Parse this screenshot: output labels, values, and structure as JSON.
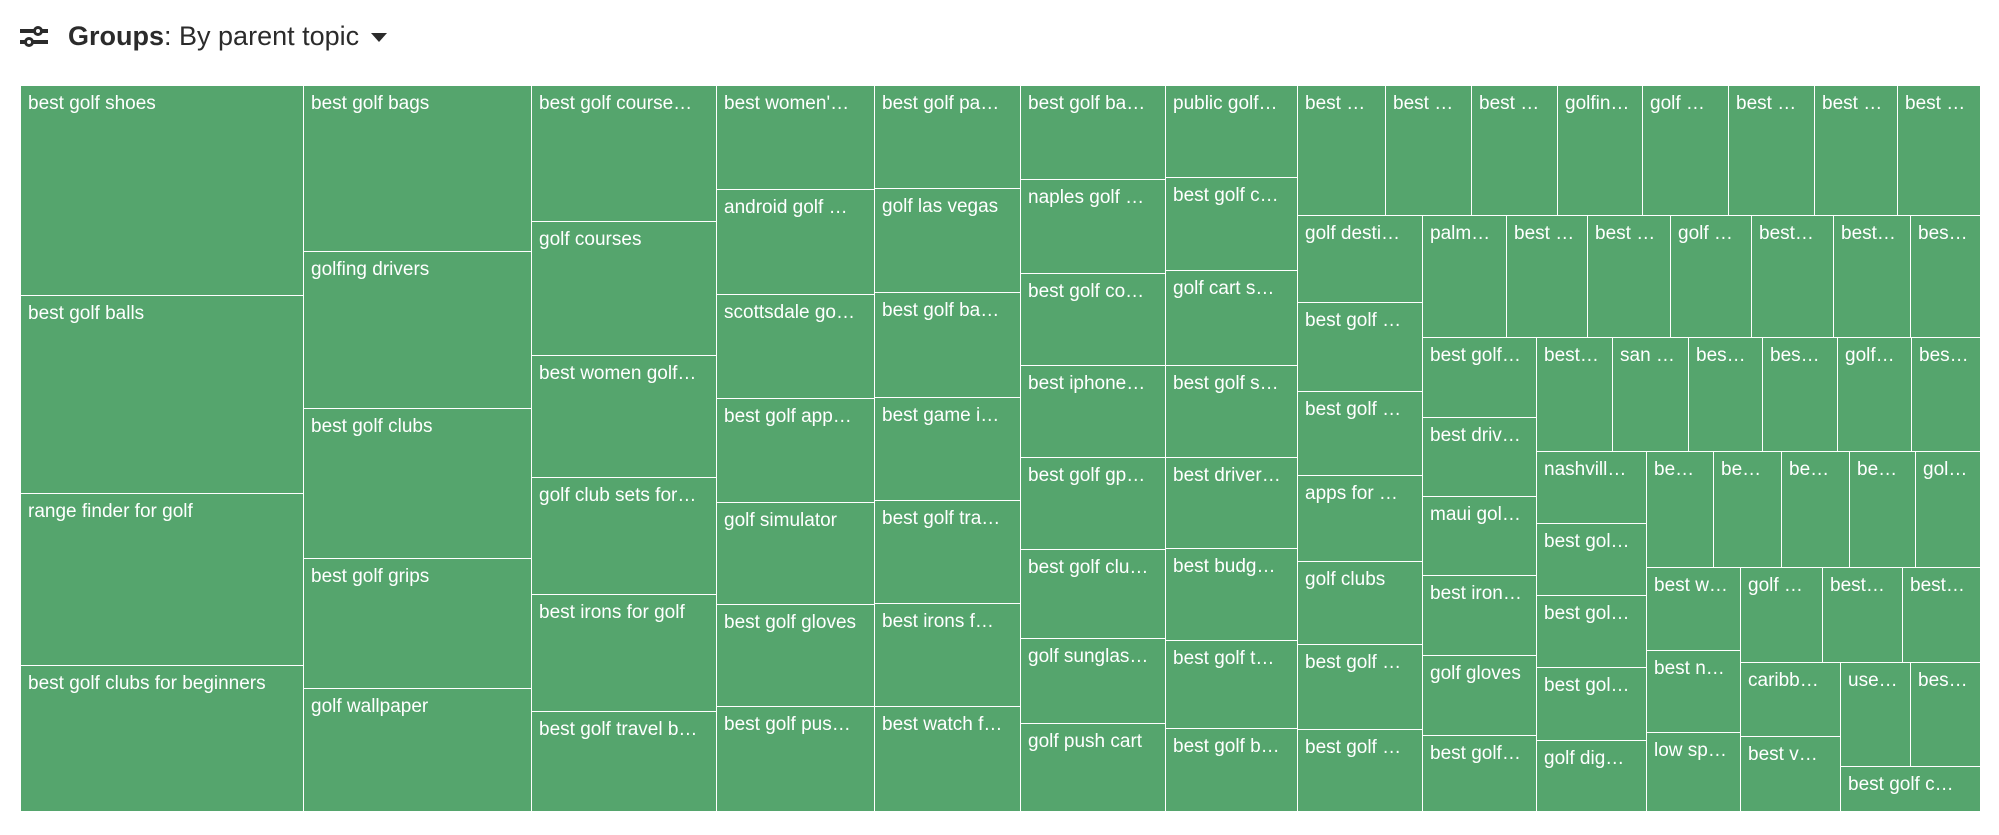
{
  "header": {
    "icon": "sliders-icon",
    "groups_label": "Groups",
    "groups_value": "By parent topic",
    "dropdown_icon": "caret-down-icon"
  },
  "colors": {
    "cell_fill": "#55a56d",
    "cell_border": "#ffffff",
    "label": "#ffffff",
    "header_text": "#2b2b2b"
  },
  "chart_data": {
    "type": "treemap",
    "title": "Groups: By parent topic",
    "cells": [
      "best golf shoes",
      "best golf balls",
      "range finder for golf",
      "best golf clubs for beginners",
      "best golf bags",
      "golfing drivers",
      "best golf clubs",
      "best golf grips",
      "golf wallpaper",
      "best golf course…",
      "golf courses",
      "best women golf…",
      "golf club sets for…",
      "best irons for golf",
      "best golf travel b…",
      "best women'…",
      "android golf …",
      "scottsdale go…",
      "best golf app…",
      "golf simulator",
      "best golf gloves",
      "best golf pus…",
      "best golf pa…",
      "golf las vegas",
      "best golf ba…",
      "best game i…",
      "best golf tra…",
      "best irons f…",
      "best watch f…",
      "best golf ba…",
      "naples golf …",
      "best golf co…",
      "best iphone…",
      "best golf gp…",
      "best golf clu…",
      "golf sunglas…",
      "golf push cart",
      "public golf…",
      "best golf c…",
      "golf cart s…",
      "best golf s…",
      "best driver…",
      "best budg…",
      "best golf t…",
      "best golf b…",
      "best …",
      "best …",
      "best …",
      "golfin…",
      "golf …",
      "best …",
      "best …",
      "best …",
      "golf desti…",
      "best golf …",
      "best golf …",
      "apps for …",
      "golf clubs",
      "best golf …",
      "best golf …",
      "palm…",
      "best …",
      "best …",
      "golf …",
      "best…",
      "best…",
      "bes…",
      "best golf…",
      "best driv…",
      "maui gol…",
      "best iron…",
      "golf gloves",
      "best golf…",
      "best…",
      "san …",
      "bes…",
      "bes…",
      "golf…",
      "bes…",
      "nashvill…",
      "best gol…",
      "best gol…",
      "best gol…",
      "golf dig…",
      "be…",
      "be…",
      "be…",
      "be…",
      "gol…",
      "best w…",
      "best n…",
      "low sp…",
      "golf …",
      "best…",
      "best…",
      "caribb…",
      "best v…",
      "use…",
      "bes…",
      "best golf c…"
    ]
  }
}
